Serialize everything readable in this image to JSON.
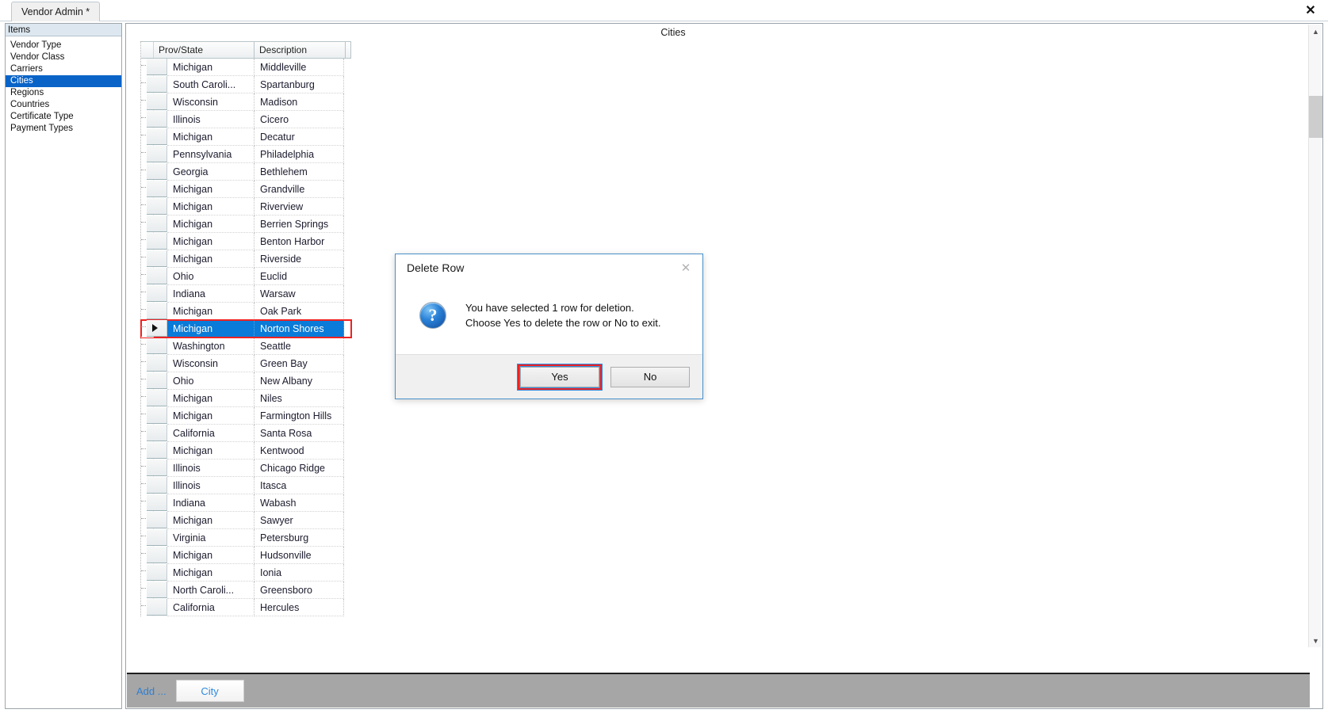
{
  "window": {
    "tab_label": "Vendor Admin *",
    "close_icon": "close-x-icon"
  },
  "sidebar": {
    "header": "Items",
    "items": [
      {
        "label": "Vendor Type",
        "selected": false
      },
      {
        "label": "Vendor Class",
        "selected": false
      },
      {
        "label": "Carriers",
        "selected": false
      },
      {
        "label": "Cities",
        "selected": true
      },
      {
        "label": "Regions",
        "selected": false
      },
      {
        "label": "Countries",
        "selected": false
      },
      {
        "label": "Certificate Type",
        "selected": false
      },
      {
        "label": "Payment Types",
        "selected": false
      }
    ]
  },
  "main": {
    "title": "Cities"
  },
  "grid": {
    "columns": [
      "Prov/State",
      "Description"
    ],
    "rows": [
      {
        "state": "Michigan",
        "description": "Middleville",
        "selected": false
      },
      {
        "state": "South Caroli...",
        "description": "Spartanburg",
        "selected": false
      },
      {
        "state": "Wisconsin",
        "description": "Madison",
        "selected": false
      },
      {
        "state": "Illinois",
        "description": "Cicero",
        "selected": false
      },
      {
        "state": "Michigan",
        "description": "Decatur",
        "selected": false
      },
      {
        "state": "Pennsylvania",
        "description": "Philadelphia",
        "selected": false
      },
      {
        "state": "Georgia",
        "description": "Bethlehem",
        "selected": false
      },
      {
        "state": "Michigan",
        "description": "Grandville",
        "selected": false
      },
      {
        "state": "Michigan",
        "description": "Riverview",
        "selected": false
      },
      {
        "state": "Michigan",
        "description": "Berrien Springs",
        "selected": false
      },
      {
        "state": "Michigan",
        "description": "Benton Harbor",
        "selected": false
      },
      {
        "state": "Michigan",
        "description": "Riverside",
        "selected": false
      },
      {
        "state": "Ohio",
        "description": "Euclid",
        "selected": false
      },
      {
        "state": "Indiana",
        "description": "Warsaw",
        "selected": false
      },
      {
        "state": "Michigan",
        "description": "Oak Park",
        "selected": false
      },
      {
        "state": "Michigan",
        "description": "Norton Shores",
        "selected": true
      },
      {
        "state": "Washington",
        "description": "Seattle",
        "selected": false
      },
      {
        "state": "Wisconsin",
        "description": "Green Bay",
        "selected": false
      },
      {
        "state": "Ohio",
        "description": "New Albany",
        "selected": false
      },
      {
        "state": "Michigan",
        "description": "Niles",
        "selected": false
      },
      {
        "state": "Michigan",
        "description": "Farmington Hills",
        "selected": false
      },
      {
        "state": "California",
        "description": "Santa Rosa",
        "selected": false
      },
      {
        "state": "Michigan",
        "description": "Kentwood",
        "selected": false
      },
      {
        "state": "Illinois",
        "description": "Chicago Ridge",
        "selected": false
      },
      {
        "state": "Illinois",
        "description": "Itasca",
        "selected": false
      },
      {
        "state": "Indiana",
        "description": "Wabash",
        "selected": false
      },
      {
        "state": "Michigan",
        "description": "Sawyer",
        "selected": false
      },
      {
        "state": "Virginia",
        "description": "Petersburg",
        "selected": false
      },
      {
        "state": "Michigan",
        "description": "Hudsonville",
        "selected": false
      },
      {
        "state": "Michigan",
        "description": "Ionia",
        "selected": false
      },
      {
        "state": "North Caroli...",
        "description": "Greensboro",
        "selected": false
      },
      {
        "state": "California",
        "description": "Hercules",
        "selected": false
      }
    ]
  },
  "scrollbar": {
    "up_icon": "chevron-up-icon",
    "down_icon": "chevron-down-icon"
  },
  "toolbar": {
    "add_label": "Add ...",
    "city_button": "City"
  },
  "dialog": {
    "title": "Delete Row",
    "close_icon": "close-x-icon",
    "question_icon": "question-mark-icon",
    "message_line1": "You have selected 1 row for deletion.",
    "message_line2": "Choose Yes to delete the row or No to exit.",
    "yes_label": "Yes",
    "no_label": "No"
  },
  "colors": {
    "selection_blue": "#0a7bd8",
    "sidebar_selection": "#0a64c8",
    "highlight_red": "#ee2222",
    "link_blue": "#2f8ae0"
  }
}
